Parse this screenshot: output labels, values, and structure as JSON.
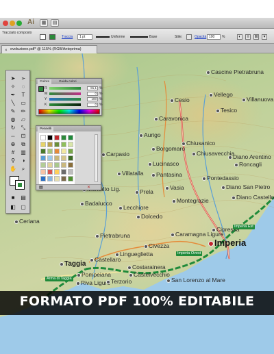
{
  "window": {
    "logo": "Ai",
    "traffic_colors": [
      "#e0443e",
      "#dea123",
      "#27aa35"
    ]
  },
  "controlbar": {
    "object_type": "Tracciato composto",
    "stroke_link": "Traccia",
    "stroke_weight": "1 pt",
    "profile": "Uniforme",
    "brush": "Base",
    "opacity_label": "Stile:",
    "opacity_link": "Opacità",
    "opacity_value": "100",
    "percent": "%"
  },
  "document": {
    "tab_title": "evoluzione.pdf* @ 115% (RGB/Anteprima)"
  },
  "color_panel": {
    "tabs": [
      "Colore",
      "Guida colori"
    ],
    "channels": [
      {
        "name": "R",
        "value": "81,1"
      },
      {
        "name": "M",
        "value": "0"
      },
      {
        "name": "Y",
        "value": "100"
      },
      {
        "name": "K",
        "value": "0"
      }
    ],
    "unit": "%"
  },
  "swatches_panel": {
    "title": "Pennelli"
  },
  "map": {
    "places": [
      {
        "name": "Cesio",
        "kind": "normal"
      },
      {
        "name": "Vellego",
        "kind": "normal"
      },
      {
        "name": "Villanuova",
        "kind": "normal"
      },
      {
        "name": "Cascine Pietrabruna",
        "kind": "normal"
      },
      {
        "name": "Caravonica",
        "kind": "normal"
      },
      {
        "name": "Tesico",
        "kind": "normal"
      },
      {
        "name": "Aurigo",
        "kind": "normal"
      },
      {
        "name": "Chiusanico",
        "kind": "normal"
      },
      {
        "name": "Borgomaro",
        "kind": "normal"
      },
      {
        "name": "Chiusavecchia",
        "kind": "normal"
      },
      {
        "name": "Diano Arentino",
        "kind": "normal"
      },
      {
        "name": "Carpasio",
        "kind": "normal"
      },
      {
        "name": "Roncagli",
        "kind": "normal"
      },
      {
        "name": "Villatalla",
        "kind": "normal"
      },
      {
        "name": "Lucinasco",
        "kind": "normal"
      },
      {
        "name": "Pantasina",
        "kind": "normal"
      },
      {
        "name": "Pontedassio",
        "kind": "normal"
      },
      {
        "name": "Diano San Pietro",
        "kind": "normal"
      },
      {
        "name": "Prela",
        "kind": "normal"
      },
      {
        "name": "Vasia",
        "kind": "normal"
      },
      {
        "name": "Montalto Lig.",
        "kind": "normal"
      },
      {
        "name": "Diano Castello",
        "kind": "normal"
      },
      {
        "name": "Badalucco",
        "kind": "normal"
      },
      {
        "name": "Montegrazie",
        "kind": "normal"
      },
      {
        "name": "Lecchiore",
        "kind": "normal"
      },
      {
        "name": "Dolcedo",
        "kind": "normal"
      },
      {
        "name": "Ceriana",
        "kind": "normal"
      },
      {
        "name": "Caramagna Ligure",
        "kind": "normal"
      },
      {
        "name": "Pietrabruna",
        "kind": "normal"
      },
      {
        "name": "Imperia",
        "kind": "big"
      },
      {
        "name": "Cipressa",
        "kind": "normal"
      },
      {
        "name": "Civezza",
        "kind": "normal"
      },
      {
        "name": "Lingueglietta",
        "kind": "normal"
      },
      {
        "name": "Castellaro",
        "kind": "normal"
      },
      {
        "name": "Taggia",
        "kind": "med"
      },
      {
        "name": "Costarainera",
        "kind": "normal"
      },
      {
        "name": "Pompeiana",
        "kind": "normal"
      },
      {
        "name": "San Lorenzo al Mare",
        "kind": "normal"
      },
      {
        "name": "Riva Ligure",
        "kind": "normal"
      },
      {
        "name": "Terzorio",
        "kind": "normal"
      },
      {
        "name": "Castelvecchio",
        "kind": "normal"
      }
    ],
    "road_tags": [
      "Imperia Est",
      "Imperia Ovest",
      "Arma di Taggia"
    ]
  },
  "banner": {
    "text": "FORMATO PDF 100% EDITABILE"
  }
}
